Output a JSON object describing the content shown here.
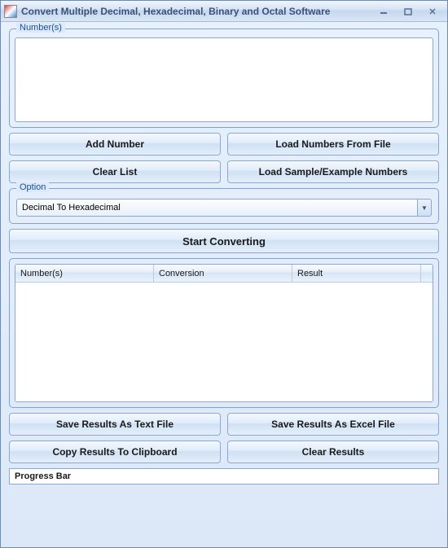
{
  "window": {
    "title": "Convert Multiple Decimal, Hexadecimal, Binary and Octal Software"
  },
  "input": {
    "group_label": "Number(s)"
  },
  "buttons": {
    "add_number": "Add Number",
    "load_from_file": "Load Numbers From File",
    "clear_list": "Clear List",
    "load_sample": "Load Sample/Example Numbers",
    "start": "Start Converting",
    "save_text": "Save Results As Text File",
    "save_excel": "Save Results As Excel File",
    "copy_clipboard": "Copy Results To Clipboard",
    "clear_results": "Clear Results"
  },
  "option": {
    "group_label": "Option",
    "selected": "Decimal To Hexadecimal"
  },
  "results": {
    "columns": {
      "numbers": "Number(s)",
      "conversion": "Conversion",
      "result": "Result"
    }
  },
  "progress": {
    "label": "Progress Bar"
  }
}
